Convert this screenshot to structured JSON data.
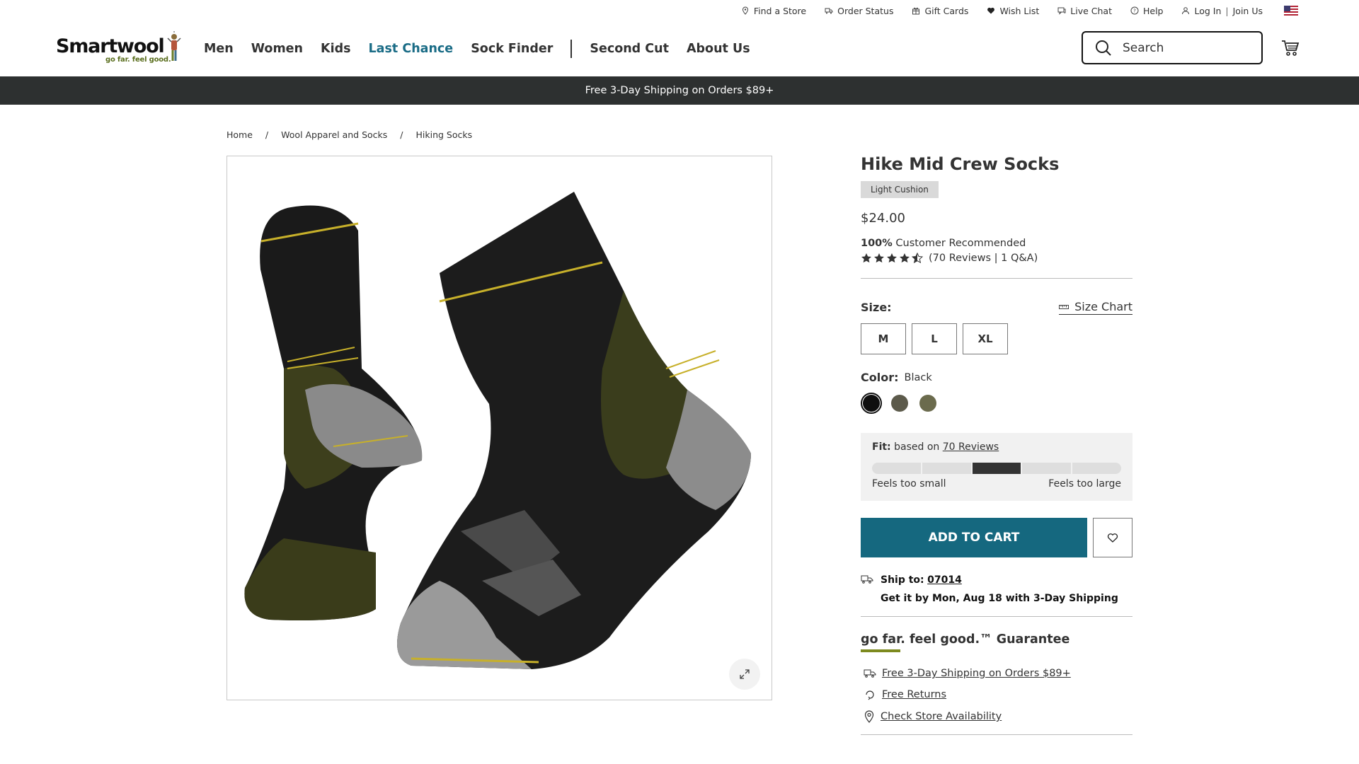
{
  "utility": {
    "find_store": "Find a Store",
    "order_status": "Order Status",
    "gift_cards": "Gift Cards",
    "wish_list": "Wish List",
    "live_chat": "Live Chat",
    "help": "Help",
    "log_in": "Log In",
    "separator": "|",
    "join_us": "Join Us"
  },
  "brand": {
    "name": "Smartwool",
    "tagline": "go far. feel good."
  },
  "nav": {
    "men": "Men",
    "women": "Women",
    "kids": "Kids",
    "last_chance": "Last Chance",
    "sock_finder": "Sock Finder",
    "second_cut": "Second Cut",
    "about_us": "About Us"
  },
  "search": {
    "placeholder": "Search"
  },
  "promo_banner": "Free 3-Day Shipping on Orders $89+",
  "breadcrumb": {
    "home": "Home",
    "sep": "/",
    "category": "Wool Apparel and Socks",
    "current": "Hiking Socks"
  },
  "product": {
    "title": "Hike Mid Crew Socks",
    "badge": "Light Cushion",
    "price": "$24.00",
    "recommend_pct": "100%",
    "recommend_text": "Customer Recommended",
    "rating": 4.5,
    "reviews_text": "(70 Reviews | 1 Q&A)",
    "size_label": "Size:",
    "size_chart": "Size Chart",
    "sizes": [
      "M",
      "L",
      "XL"
    ],
    "color_label": "Color:",
    "color_value": "Black",
    "swatch_colors": [
      "#0e0e0e",
      "#5c5a4b",
      "#6b6b4d"
    ],
    "fit": {
      "label": "Fit:",
      "based_on": "based on",
      "reviews_link": "70 Reviews",
      "selected_segment": 3,
      "segment_count": 5,
      "small_label": "Feels too small",
      "large_label": "Feels too large"
    },
    "add_to_cart": "ADD TO CART",
    "ship_to_label": "Ship to:",
    "zip": "07014",
    "delivery": "Get it by Mon, Aug 18 with 3-Day Shipping",
    "guarantee_title": "go far. feel good.™ Guarantee",
    "perk_shipping": "Free 3-Day Shipping on Orders $89+",
    "perk_returns": "Free Returns",
    "perk_store": "Check Store Availability"
  },
  "colors": {
    "accent": "#1a6c86",
    "cart_button": "#15687f",
    "banner": "#2d3030",
    "guarantee_underline": "#7d8a1f"
  }
}
